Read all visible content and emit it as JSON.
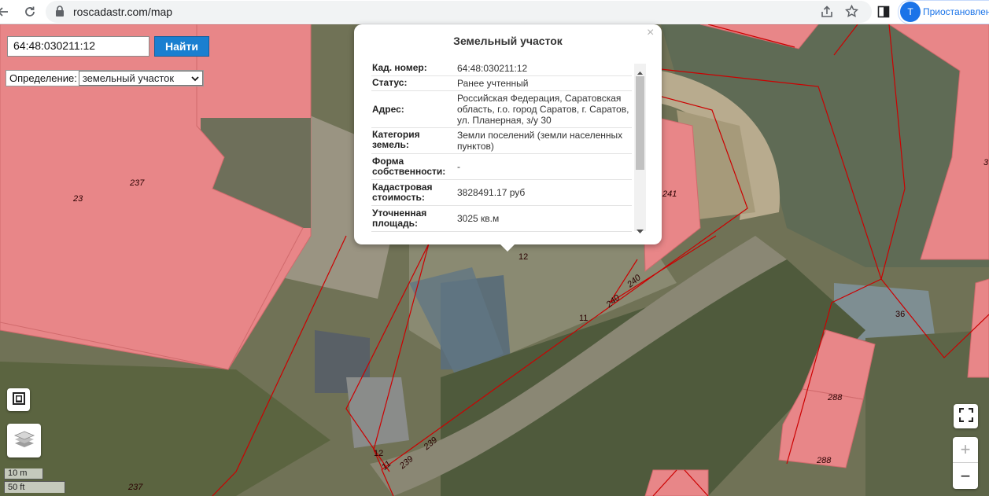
{
  "browser": {
    "url": "roscadastr.com/map",
    "profile_initial": "T",
    "profile_label": "Приостановлено"
  },
  "search": {
    "input_value": "64:48:030211:12",
    "button_label": "Найти",
    "definition_label": "Определение:",
    "definition_selected": "земельный участок"
  },
  "popup": {
    "title": "Земельный участок",
    "close": "×",
    "rows": [
      {
        "label": "Кад. номер:",
        "value": "64:48:030211:12"
      },
      {
        "label": "Статус:",
        "value": "Ранее учтенный"
      },
      {
        "label": "Адрес:",
        "value": "Российская Федерация, Саратовская область, г.о. город Саратов, г. Саратов, ул. Планерная, з/у 30"
      },
      {
        "label": "Категория земель:",
        "value": "Земли поселений (земли населенных пунктов)"
      },
      {
        "label": "Форма собственности:",
        "value": "-"
      },
      {
        "label": "Кадастровая стоимость:",
        "value": "3828491.17 руб"
      },
      {
        "label": "Уточненная площадь:",
        "value": "3025 кв.м"
      }
    ]
  },
  "map_labels": {
    "p237a": "237",
    "p23": "23",
    "p241": "241",
    "p12a": "12",
    "p240": "240",
    "p240b": "240",
    "p11a": "11",
    "p36": "36",
    "p288a": "288",
    "p288b": "288",
    "p3": "3",
    "p12b": "12",
    "p11b": "11",
    "p239a": "239",
    "p239b": "239",
    "p237b": "237"
  },
  "controls": {
    "zoom_in": "+",
    "zoom_out": "−",
    "scale_metric": "10 m",
    "scale_imperial": "50 ft"
  },
  "colors": {
    "parcel_fill": "#e88688",
    "parcel_border": "#cc0000",
    "search_button": "#1a7fd0",
    "accent": "#1a73e8"
  }
}
